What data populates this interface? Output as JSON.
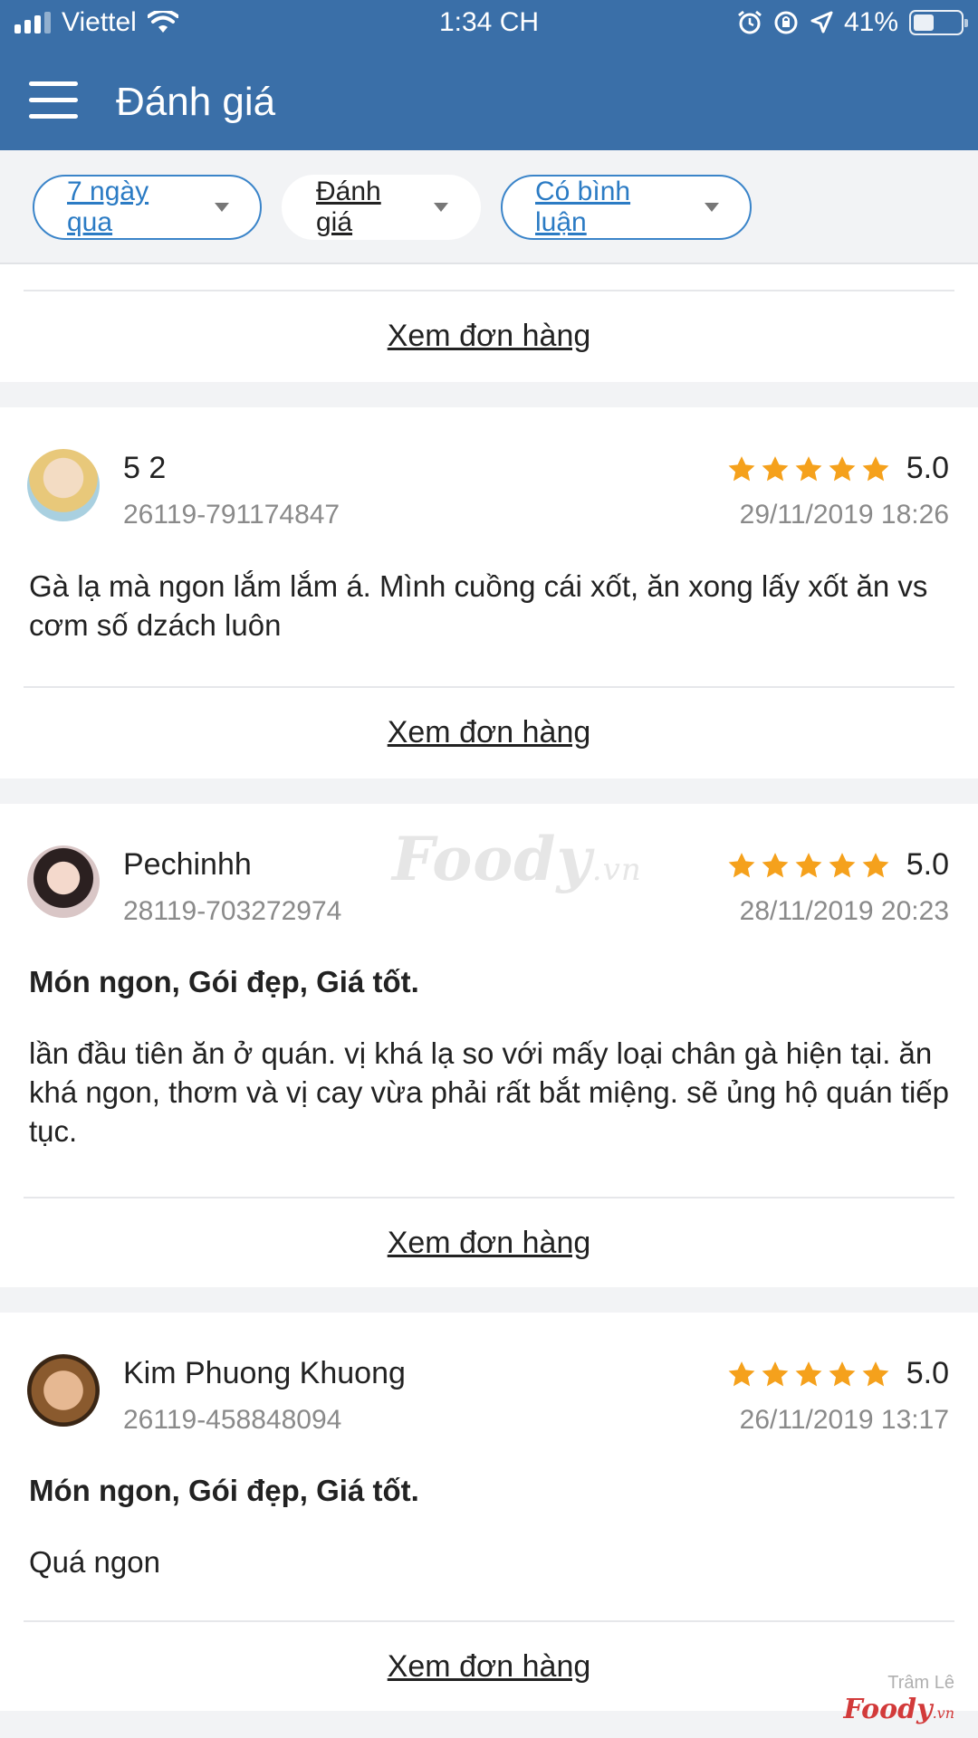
{
  "status": {
    "carrier": "Viettel",
    "time": "1:34 CH",
    "battery": "41%"
  },
  "header": {
    "title": "Đánh giá"
  },
  "filters": [
    {
      "label": "7 ngày qua",
      "active": true
    },
    {
      "label": "Đánh giá",
      "active": false
    },
    {
      "label": "Có bình luận",
      "active": true
    }
  ],
  "view_order_label": "Xem đơn hàng",
  "reviews": [
    {
      "name": "5 2",
      "order_id": "26119-791174847",
      "rating": "5.0",
      "date": "29/11/2019 18:26",
      "tags": "",
      "comment": "Gà lạ mà ngon lắm lắm á. Mình cuồng cái xốt, ăn xong lấy xốt ăn vs cơm số dzách luôn"
    },
    {
      "name": "Pechinhh",
      "order_id": "28119-703272974",
      "rating": "5.0",
      "date": "28/11/2019 20:23",
      "tags": "Món ngon, Gói đẹp, Giá tốt.",
      "comment": "lần đầu tiên ăn ở quán. vị khá lạ so với mấy loại chân gà hiện tại. ăn khá ngon, thơm và vị cay vừa phải rất bắt miệng. sẽ ủng hộ quán tiếp tục."
    },
    {
      "name": "Kim Phuong Khuong",
      "order_id": "26119-458848094",
      "rating": "5.0",
      "date": "26/11/2019 13:17",
      "tags": "Món ngon, Gói đẹp, Giá tốt.",
      "comment": "Quá ngon"
    }
  ],
  "watermark": {
    "text": "Foody",
    "suffix": ".vn"
  },
  "corner": {
    "author": "Trâm Lê",
    "brand": "Foody",
    "suffix": ".vn"
  },
  "colors": {
    "header": "#3a6fa8",
    "accent": "#2b7bc4",
    "star": "#f5a11c"
  }
}
